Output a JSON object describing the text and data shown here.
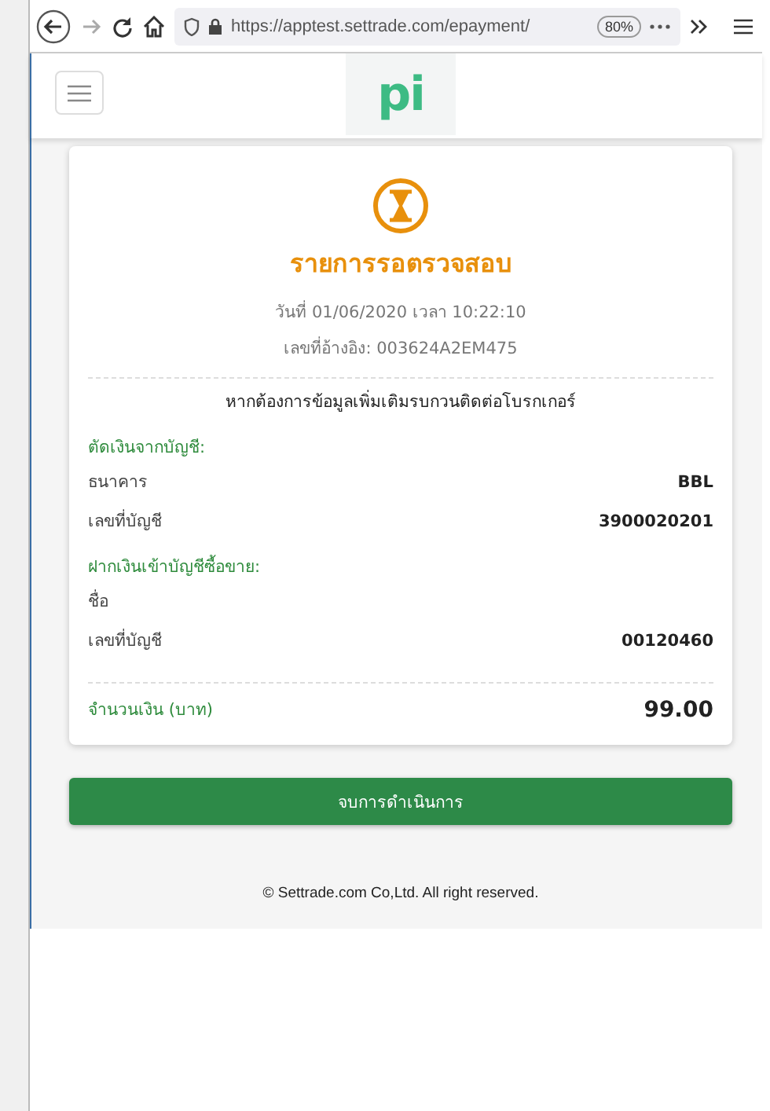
{
  "browser": {
    "url": "https://apptest.settrade.com/epayment/",
    "zoom": "80%"
  },
  "header": {
    "logo": "pi"
  },
  "receipt": {
    "status": "รายการรอตรวจสอบ",
    "datetime": "วันที่ 01/06/2020 เวลา 10:22:10",
    "reference": "เลขที่อ้างอิง: 003624A2EM475",
    "notice": "หากต้องการข้อมูลเพิ่มเติมรบกวนติดต่อโบรกเกอร์",
    "sections": [
      {
        "title": "ตัดเงินจากบัญชี:",
        "rows": [
          {
            "label": "ธนาคาร",
            "value": "BBL"
          },
          {
            "label": "เลขที่บัญชี",
            "value": "3900020201"
          }
        ]
      },
      {
        "title": "ฝากเงินเข้าบัญชีซื้อขาย:",
        "rows": [
          {
            "label": "ชื่อ"
          },
          {
            "label": "เลขที่บัญชี",
            "value": "00120460"
          }
        ]
      }
    ],
    "total": {
      "label": "จำนวนเงิน (บาท)",
      "value": "99.00"
    }
  },
  "finish_button": "จบการดำเนินการ",
  "footer": "© Settrade.com Co,Ltd. All right reserved."
}
